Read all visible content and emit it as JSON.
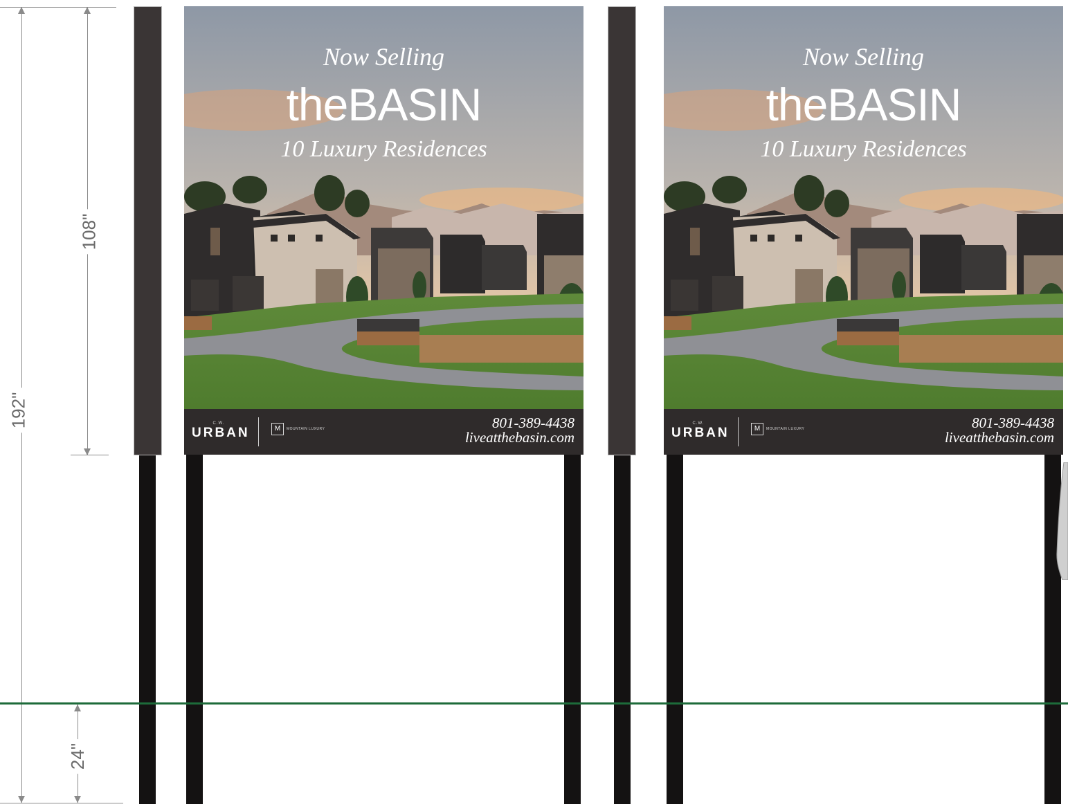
{
  "dimensions": {
    "overall_height": "192\"",
    "sign_height": "108\"",
    "ground_clearance": "24\""
  },
  "signs": [
    {
      "headline": "Now Selling",
      "brand": "theBASIN",
      "subtitle": "10 Luxury Residences",
      "logo_small": "C.W.",
      "logo_main": "URBAN",
      "partner_logo": "MOUNTAIN LUXURY",
      "phone": "801-389-4438",
      "website": "liveatthebasin.com"
    },
    {
      "headline": "Now Selling",
      "brand": "theBASIN",
      "subtitle": "10 Luxury Residences",
      "logo_small": "C.W.",
      "logo_main": "URBAN",
      "partner_logo": "MOUNTAIN LUXURY",
      "phone": "801-389-4438",
      "website": "liveatthebasin.com"
    }
  ],
  "colors": {
    "ground_line": "#1d6b3a",
    "post": "#141212",
    "footer": "#2f2b2b",
    "dimension_line": "#8a8a8a"
  }
}
